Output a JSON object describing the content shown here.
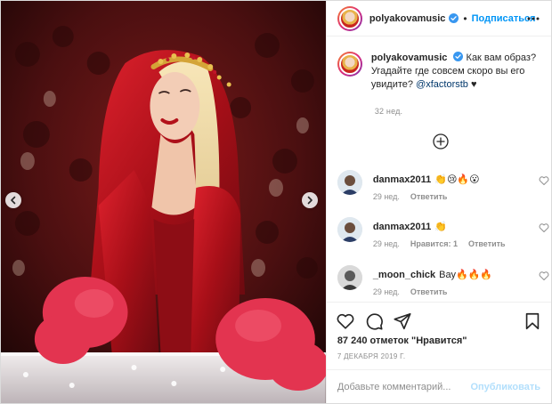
{
  "header": {
    "username": "polyakovamusic",
    "separator": "•",
    "follow_label": "Подписаться"
  },
  "caption": {
    "username": "polyakovamusic",
    "text": "Как вам образ? Угадайте где совсем скоро вы его увидите?",
    "mention": "@xfactorstb",
    "suffix": "♥",
    "time": "32 нед."
  },
  "comments": [
    {
      "username": "danmax2011",
      "text": "👏😢🔥😮",
      "time": "29 нед.",
      "likes": "",
      "reply_label": "Ответить"
    },
    {
      "username": "danmax2011",
      "text": "👏",
      "time": "29 нед.",
      "likes": "Нравится: 1",
      "reply_label": "Ответить"
    },
    {
      "username": "_moon_chick",
      "text": "Вау🔥🔥🔥",
      "time": "29 нед.",
      "likes": "",
      "reply_label": "Ответить"
    }
  ],
  "likes_text": "87 240 отметок \"Нравится\"",
  "date_text": "7 ДЕКАБРЯ 2019 Г.",
  "add_comment": {
    "placeholder": "Добавьте комментарий...",
    "post_label": "Опубликовать"
  },
  "icons": {
    "verified": "verified-badge-icon",
    "more": "more-options-icon",
    "load_more": "plus-circle-icon",
    "like": "heart-outline-icon",
    "comment": "comment-bubble-icon",
    "share": "paper-plane-icon",
    "save": "bookmark-icon",
    "prev": "chevron-left-icon",
    "next": "chevron-right-icon"
  },
  "colors": {
    "accent": "#0095f6",
    "post_disabled": "#b2dffc",
    "muted": "#8e8e8e",
    "dress_red": "#c1121f"
  }
}
